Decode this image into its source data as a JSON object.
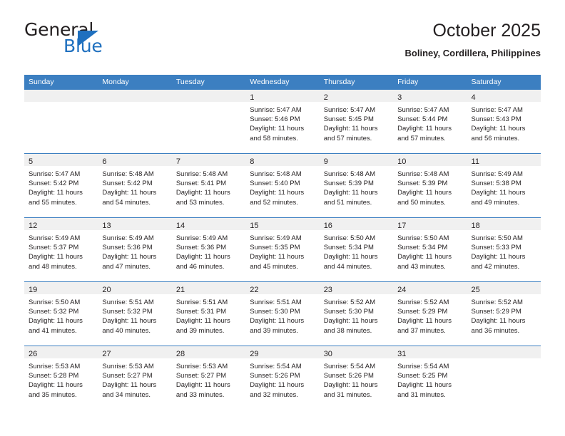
{
  "brand": {
    "name_part1": "General",
    "name_part2": "Blue",
    "accent_color": "#1f70bf",
    "triangle_icon": "triangle-flag-icon"
  },
  "header": {
    "title": "October 2025",
    "subtitle": "Boliney, Cordillera, Philippines"
  },
  "calendar": {
    "header_bg": "#3c7fc1",
    "daynum_band_bg": "#f0f0f0",
    "weekday_headers": [
      "Sunday",
      "Monday",
      "Tuesday",
      "Wednesday",
      "Thursday",
      "Friday",
      "Saturday"
    ],
    "weeks": [
      [
        {
          "day": "",
          "lines": []
        },
        {
          "day": "",
          "lines": []
        },
        {
          "day": "",
          "lines": []
        },
        {
          "day": "1",
          "lines": [
            "Sunrise: 5:47 AM",
            "Sunset: 5:46 PM",
            "Daylight: 11 hours",
            "and 58 minutes."
          ]
        },
        {
          "day": "2",
          "lines": [
            "Sunrise: 5:47 AM",
            "Sunset: 5:45 PM",
            "Daylight: 11 hours",
            "and 57 minutes."
          ]
        },
        {
          "day": "3",
          "lines": [
            "Sunrise: 5:47 AM",
            "Sunset: 5:44 PM",
            "Daylight: 11 hours",
            "and 57 minutes."
          ]
        },
        {
          "day": "4",
          "lines": [
            "Sunrise: 5:47 AM",
            "Sunset: 5:43 PM",
            "Daylight: 11 hours",
            "and 56 minutes."
          ]
        }
      ],
      [
        {
          "day": "5",
          "lines": [
            "Sunrise: 5:47 AM",
            "Sunset: 5:42 PM",
            "Daylight: 11 hours",
            "and 55 minutes."
          ]
        },
        {
          "day": "6",
          "lines": [
            "Sunrise: 5:48 AM",
            "Sunset: 5:42 PM",
            "Daylight: 11 hours",
            "and 54 minutes."
          ]
        },
        {
          "day": "7",
          "lines": [
            "Sunrise: 5:48 AM",
            "Sunset: 5:41 PM",
            "Daylight: 11 hours",
            "and 53 minutes."
          ]
        },
        {
          "day": "8",
          "lines": [
            "Sunrise: 5:48 AM",
            "Sunset: 5:40 PM",
            "Daylight: 11 hours",
            "and 52 minutes."
          ]
        },
        {
          "day": "9",
          "lines": [
            "Sunrise: 5:48 AM",
            "Sunset: 5:39 PM",
            "Daylight: 11 hours",
            "and 51 minutes."
          ]
        },
        {
          "day": "10",
          "lines": [
            "Sunrise: 5:48 AM",
            "Sunset: 5:39 PM",
            "Daylight: 11 hours",
            "and 50 minutes."
          ]
        },
        {
          "day": "11",
          "lines": [
            "Sunrise: 5:49 AM",
            "Sunset: 5:38 PM",
            "Daylight: 11 hours",
            "and 49 minutes."
          ]
        }
      ],
      [
        {
          "day": "12",
          "lines": [
            "Sunrise: 5:49 AM",
            "Sunset: 5:37 PM",
            "Daylight: 11 hours",
            "and 48 minutes."
          ]
        },
        {
          "day": "13",
          "lines": [
            "Sunrise: 5:49 AM",
            "Sunset: 5:36 PM",
            "Daylight: 11 hours",
            "and 47 minutes."
          ]
        },
        {
          "day": "14",
          "lines": [
            "Sunrise: 5:49 AM",
            "Sunset: 5:36 PM",
            "Daylight: 11 hours",
            "and 46 minutes."
          ]
        },
        {
          "day": "15",
          "lines": [
            "Sunrise: 5:49 AM",
            "Sunset: 5:35 PM",
            "Daylight: 11 hours",
            "and 45 minutes."
          ]
        },
        {
          "day": "16",
          "lines": [
            "Sunrise: 5:50 AM",
            "Sunset: 5:34 PM",
            "Daylight: 11 hours",
            "and 44 minutes."
          ]
        },
        {
          "day": "17",
          "lines": [
            "Sunrise: 5:50 AM",
            "Sunset: 5:34 PM",
            "Daylight: 11 hours",
            "and 43 minutes."
          ]
        },
        {
          "day": "18",
          "lines": [
            "Sunrise: 5:50 AM",
            "Sunset: 5:33 PM",
            "Daylight: 11 hours",
            "and 42 minutes."
          ]
        }
      ],
      [
        {
          "day": "19",
          "lines": [
            "Sunrise: 5:50 AM",
            "Sunset: 5:32 PM",
            "Daylight: 11 hours",
            "and 41 minutes."
          ]
        },
        {
          "day": "20",
          "lines": [
            "Sunrise: 5:51 AM",
            "Sunset: 5:32 PM",
            "Daylight: 11 hours",
            "and 40 minutes."
          ]
        },
        {
          "day": "21",
          "lines": [
            "Sunrise: 5:51 AM",
            "Sunset: 5:31 PM",
            "Daylight: 11 hours",
            "and 39 minutes."
          ]
        },
        {
          "day": "22",
          "lines": [
            "Sunrise: 5:51 AM",
            "Sunset: 5:30 PM",
            "Daylight: 11 hours",
            "and 39 minutes."
          ]
        },
        {
          "day": "23",
          "lines": [
            "Sunrise: 5:52 AM",
            "Sunset: 5:30 PM",
            "Daylight: 11 hours",
            "and 38 minutes."
          ]
        },
        {
          "day": "24",
          "lines": [
            "Sunrise: 5:52 AM",
            "Sunset: 5:29 PM",
            "Daylight: 11 hours",
            "and 37 minutes."
          ]
        },
        {
          "day": "25",
          "lines": [
            "Sunrise: 5:52 AM",
            "Sunset: 5:29 PM",
            "Daylight: 11 hours",
            "and 36 minutes."
          ]
        }
      ],
      [
        {
          "day": "26",
          "lines": [
            "Sunrise: 5:53 AM",
            "Sunset: 5:28 PM",
            "Daylight: 11 hours",
            "and 35 minutes."
          ]
        },
        {
          "day": "27",
          "lines": [
            "Sunrise: 5:53 AM",
            "Sunset: 5:27 PM",
            "Daylight: 11 hours",
            "and 34 minutes."
          ]
        },
        {
          "day": "28",
          "lines": [
            "Sunrise: 5:53 AM",
            "Sunset: 5:27 PM",
            "Daylight: 11 hours",
            "and 33 minutes."
          ]
        },
        {
          "day": "29",
          "lines": [
            "Sunrise: 5:54 AM",
            "Sunset: 5:26 PM",
            "Daylight: 11 hours",
            "and 32 minutes."
          ]
        },
        {
          "day": "30",
          "lines": [
            "Sunrise: 5:54 AM",
            "Sunset: 5:26 PM",
            "Daylight: 11 hours",
            "and 31 minutes."
          ]
        },
        {
          "day": "31",
          "lines": [
            "Sunrise: 5:54 AM",
            "Sunset: 5:25 PM",
            "Daylight: 11 hours",
            "and 31 minutes."
          ]
        },
        {
          "day": "",
          "lines": []
        }
      ]
    ]
  }
}
